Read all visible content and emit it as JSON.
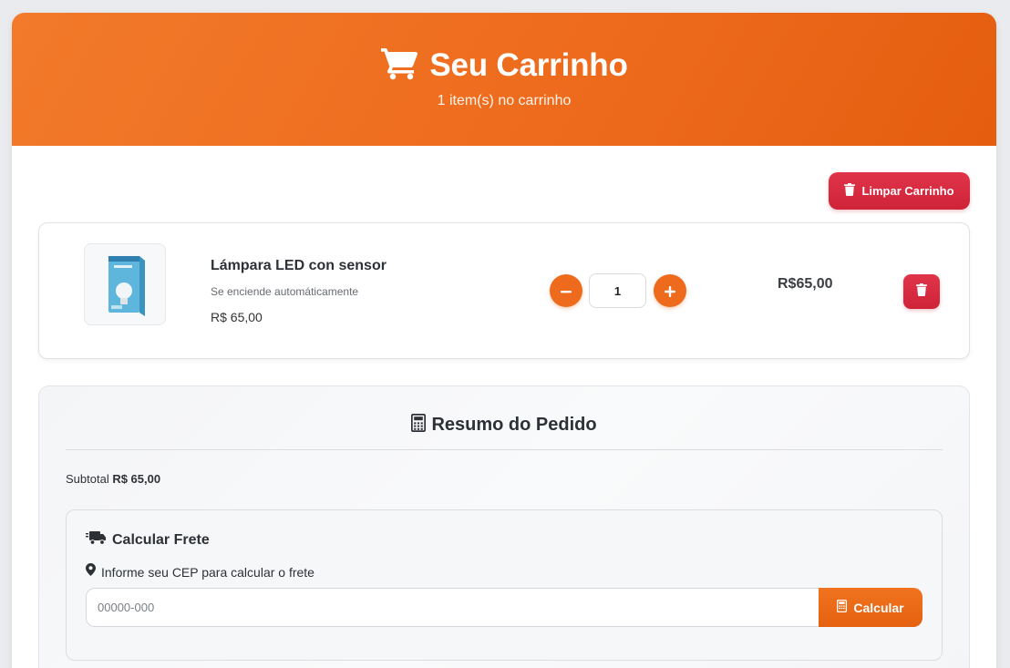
{
  "header": {
    "title": "Seu Carrinho",
    "subtitle": "1 item(s) no carrinho",
    "icon": "shopping-cart-icon"
  },
  "actions": {
    "clear_label": "Limpar Carrinho"
  },
  "cart_items": [
    {
      "name": "Lámpara LED con sensor",
      "description": "Se enciende automáticamente",
      "unit_price": "R$ 65,00",
      "quantity": "1",
      "total": "R$65,00"
    }
  ],
  "summary": {
    "title": "Resumo do Pedido",
    "subtotal_label": "Subtotal",
    "subtotal_value": "R$ 65,00"
  },
  "shipping": {
    "title": "Calcular Frete",
    "hint": "Informe seu CEP para calcular o frete",
    "cep_placeholder": "00000-000",
    "calc_label": "Calcular"
  },
  "colors": {
    "accent": "#ee6b1d",
    "danger": "#d62a3f"
  }
}
